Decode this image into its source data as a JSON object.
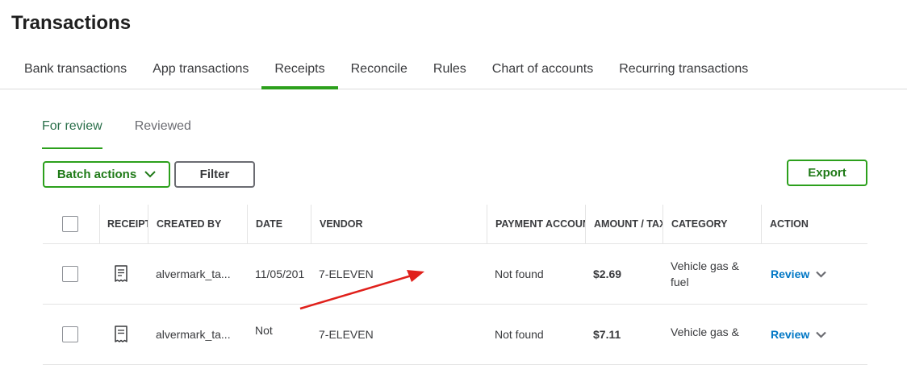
{
  "page": {
    "title": "Transactions"
  },
  "tabs": [
    {
      "label": "Bank transactions"
    },
    {
      "label": "App transactions"
    },
    {
      "label": "Receipts",
      "active": true
    },
    {
      "label": "Reconcile"
    },
    {
      "label": "Rules"
    },
    {
      "label": "Chart of accounts"
    },
    {
      "label": "Recurring transactions"
    }
  ],
  "subtabs": [
    {
      "label": "For review",
      "active": true
    },
    {
      "label": "Reviewed"
    }
  ],
  "toolbar": {
    "batch_label": "Batch actions",
    "filter_label": "Filter",
    "export_label": "Export"
  },
  "table": {
    "columns": {
      "receipt": "RECEIPT",
      "created_by": "CREATED BY",
      "date": "DATE",
      "vendor": "VENDOR",
      "payment_account": "PAYMENT ACCOUN",
      "amount": "AMOUNT / TAX",
      "category": "CATEGORY",
      "action": "ACTION"
    },
    "rows": [
      {
        "created_by": "alvermark_ta...",
        "date": "11/05/201",
        "vendor": "7-ELEVEN",
        "payment_account": "Not found",
        "amount": "$2.69",
        "category": "Vehicle gas & fuel",
        "action": "Review"
      },
      {
        "created_by": "alvermark_ta...",
        "date": "Not",
        "vendor": "7-ELEVEN",
        "payment_account": "Not found",
        "amount": "$7.11",
        "category": "Vehicle gas &",
        "action": "Review"
      }
    ]
  },
  "colors": {
    "accent": "#2ca01c",
    "link": "#0077c5",
    "annotation_arrow": "#e0201b"
  },
  "icons": {
    "receipt": "receipt-icon",
    "dropdown": "chevron-down-icon",
    "annotation": "arrow-annotation"
  }
}
